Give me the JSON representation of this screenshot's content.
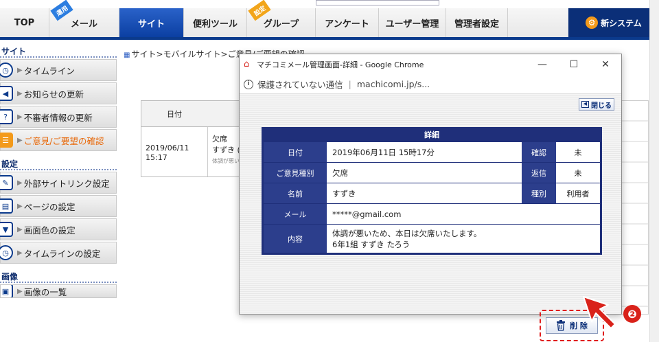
{
  "nav": {
    "tabs": [
      {
        "label": "TOP",
        "badge": ""
      },
      {
        "label": "メール",
        "badge": "運用"
      },
      {
        "label": "サイト",
        "badge": ""
      },
      {
        "label": "便利ツール",
        "badge": ""
      },
      {
        "label": "グループ",
        "badge": "設定"
      },
      {
        "label": "アンケート",
        "badge": ""
      },
      {
        "label": "ユーザー管理",
        "badge": ""
      },
      {
        "label": "管理者設定",
        "badge": ""
      }
    ],
    "new_system": "新システム"
  },
  "sidebar": {
    "site_section": "サイト",
    "site_items": [
      "タイムライン",
      "お知らせの更新",
      "不審者情報の更新",
      "ご意見/ご要望の確認"
    ],
    "settings_section": "設定",
    "settings_items": [
      "外部サイトリンク設定",
      "ページの設定",
      "画面色の設定",
      "タイムラインの設定"
    ],
    "image_section": "画像",
    "image_items": [
      "画像の一覧"
    ]
  },
  "breadcrumb": "サイト>モバイルサイト>ご意見/ご要望の確認",
  "list_table": {
    "date_header": "日付",
    "date": "2019/06/11",
    "time": "15:17",
    "type": "欠席",
    "name": "すずき (",
    "excerpt": "体調が悪い"
  },
  "popup": {
    "window_title": "マチコミメール管理画面-詳細 - Google Chrome",
    "window_controls": [
      "—",
      "☐",
      "✕"
    ],
    "address_insecure": "保護されていない通信",
    "address_url": "machicomi.jp/s...",
    "close_label": "閉じる",
    "detail": {
      "header": "詳細",
      "date_label": "日付",
      "date_value": "2019年06月11日 15時17分",
      "confirm_label": "確認",
      "confirm_value": "未",
      "type_label": "ご意見種別",
      "type_value": "欠席",
      "reply_label": "返信",
      "reply_value": "未",
      "name_label": "名前",
      "name_value": "すずき",
      "kind_label": "種別",
      "kind_value": "利用者",
      "mail_label": "メール",
      "mail_value": "*****@gmail.com",
      "content_label": "内容",
      "content_line1": "体調が悪いため、本日は欠席いたします。",
      "content_line2": "6年1組 すずき たろう"
    },
    "delete_label": "削 除"
  },
  "annotation": {
    "step": "❷",
    "color": "#d9221a"
  }
}
